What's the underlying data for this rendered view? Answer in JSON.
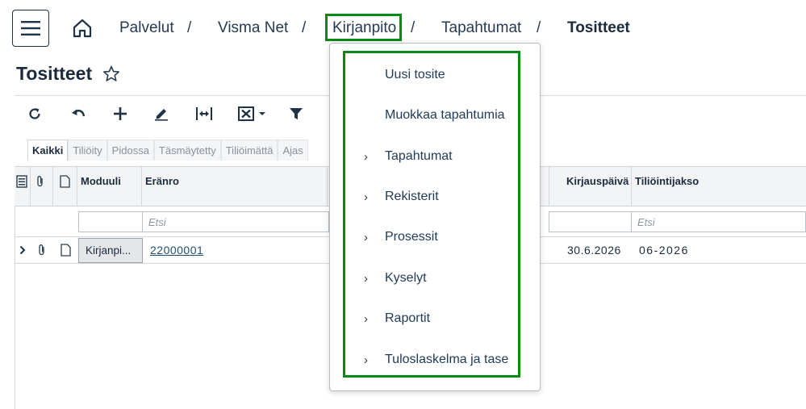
{
  "breadcrumb": {
    "items": [
      "Palvelut",
      "Visma Net",
      "Kirjanpito",
      "Tapahtumat",
      "Tositteet"
    ],
    "separator": "/"
  },
  "page": {
    "title": "Tositteet"
  },
  "tabs": [
    "Kaikki",
    "Tiliöity",
    "Pidossa",
    "Täsmäytetty",
    "Tiliöimättä",
    "Ajas"
  ],
  "grid": {
    "columns": [
      "Moduuli",
      "Eränro",
      "Kirjauspäivä",
      "Tiliöintijakso"
    ],
    "filter_placeholder": "Etsi",
    "rows": [
      {
        "module": "Kirjanpi...",
        "batch": "22000001",
        "posting_date": "30.6.2026",
        "period": "06-2026"
      }
    ]
  },
  "dropdown": {
    "items": [
      {
        "label": "Uusi tosite",
        "chevron": ""
      },
      {
        "label": "Muokkaa tapahtumia",
        "chevron": ""
      },
      {
        "label": "Tapahtumat",
        "chevron": "›"
      },
      {
        "label": "Rekisterit",
        "chevron": "›"
      },
      {
        "label": "Prosessit",
        "chevron": "›"
      },
      {
        "label": "Kyselyt",
        "chevron": "›"
      },
      {
        "label": "Raportit",
        "chevron": "›"
      },
      {
        "label": "Tuloslaskelma ja tase",
        "chevron": "›"
      }
    ]
  },
  "colors": {
    "highlight": "#0a8a12",
    "text": "#1e3a56"
  },
  "icons": [
    "menu-icon",
    "home-icon",
    "star-icon",
    "refresh-icon",
    "undo-icon",
    "add-icon",
    "edit-icon",
    "fit-columns-icon",
    "excel-icon",
    "filter-icon"
  ]
}
